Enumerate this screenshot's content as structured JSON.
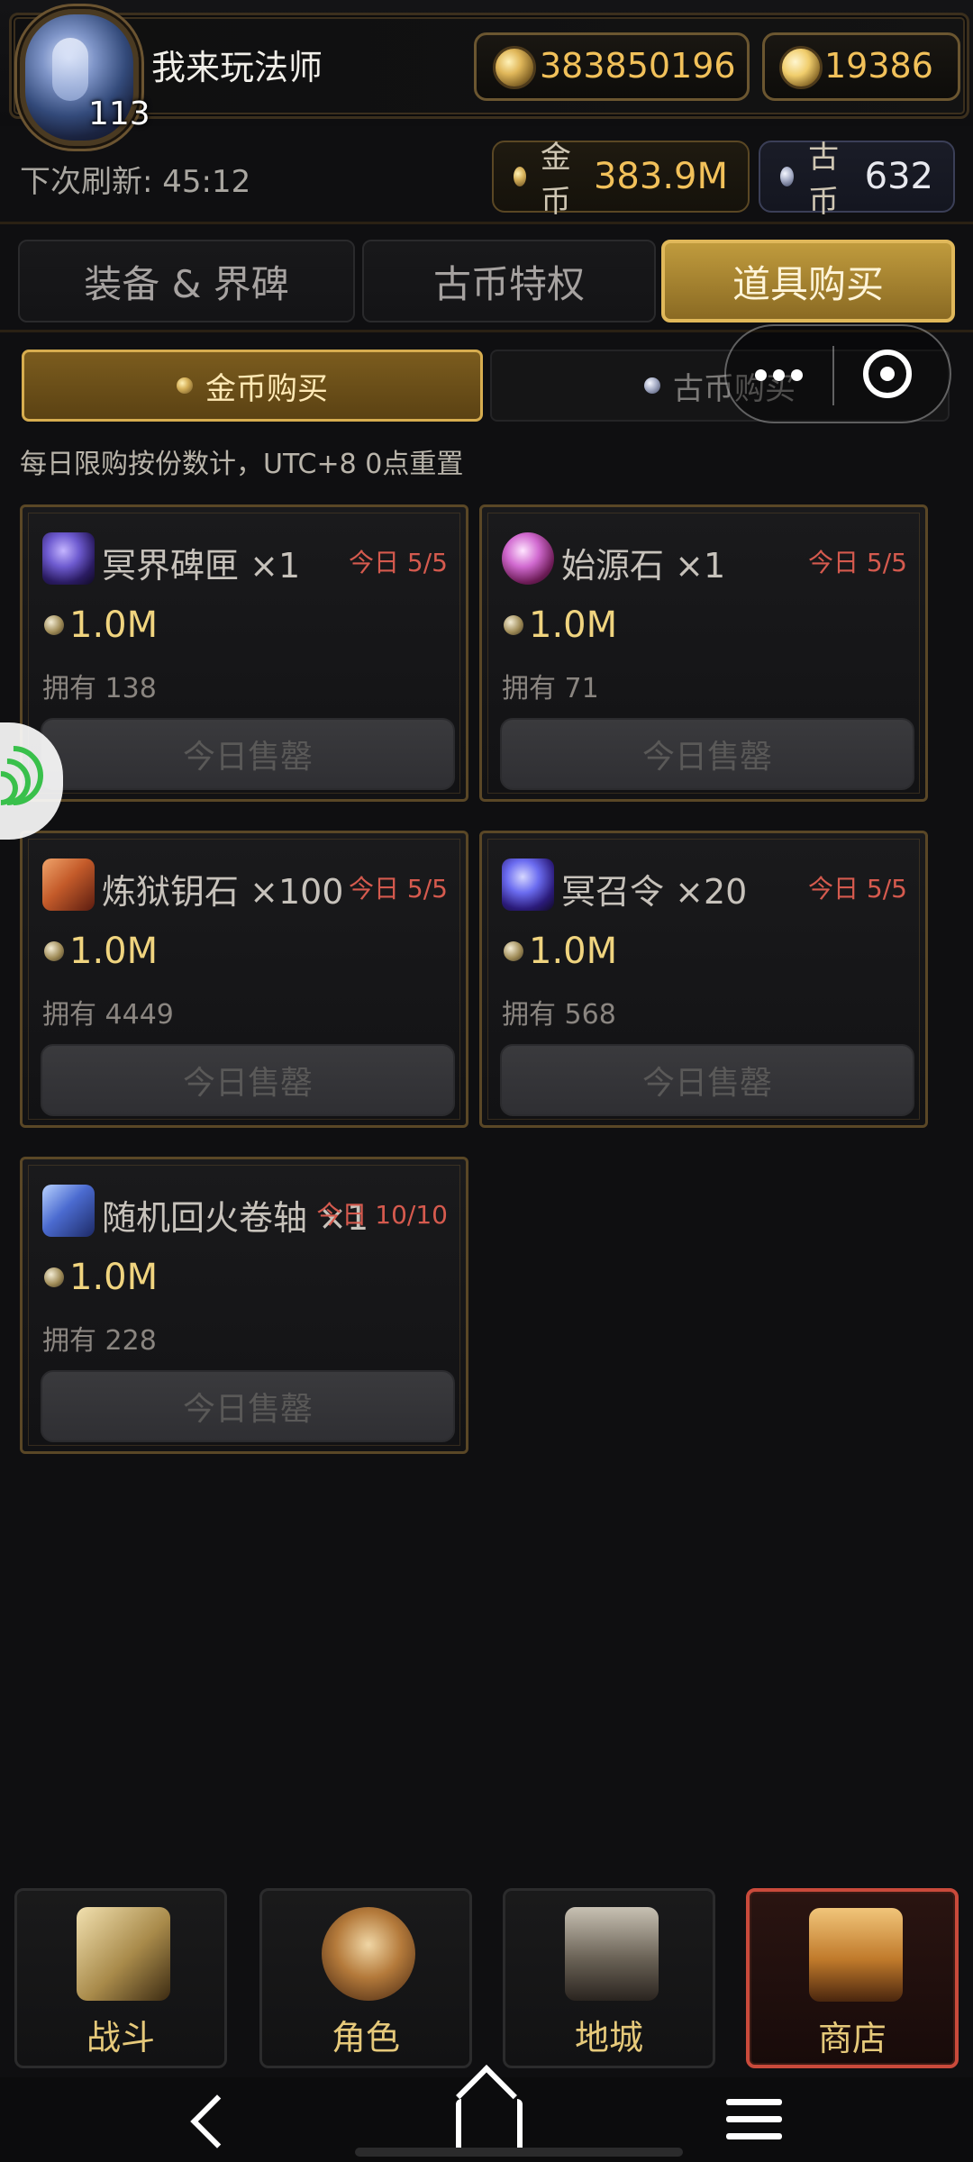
{
  "header": {
    "player_name": "我来玩法师",
    "level": "113",
    "currency_primary": "383850196",
    "currency_secondary": "19386"
  },
  "status": {
    "next_refresh_label": "下次刷新:",
    "next_refresh_time": "45:12",
    "gold_label": "金币",
    "gold_value": "383.9M",
    "ancient_label": "古币",
    "ancient_value": "632"
  },
  "tabs": {
    "main": [
      {
        "label": "装备 & 界碑",
        "active": false
      },
      {
        "label": "古币特权",
        "active": false
      },
      {
        "label": "道具购买",
        "active": true
      }
    ],
    "sub": [
      {
        "label": "金币购买",
        "active": true
      },
      {
        "label": "古币购买",
        "active": false
      }
    ]
  },
  "note": "每日限购按份数计，UTC+8 0点重置",
  "items": [
    {
      "name": "冥界碑匣",
      "qty": "×1",
      "daily": "今日 5/5",
      "price": "1.0M",
      "owned": "拥有 138",
      "button": "今日售罄",
      "icon": "box-icon"
    },
    {
      "name": "始源石",
      "qty": "×1",
      "daily": "今日 5/5",
      "price": "1.0M",
      "owned": "拥有 71",
      "button": "今日售罄",
      "icon": "gem-icon"
    },
    {
      "name": "炼狱钥石",
      "qty": "×100",
      "daily": "今日 5/5",
      "price": "1.0M",
      "owned": "拥有 4449",
      "button": "今日售罄",
      "icon": "key-icon"
    },
    {
      "name": "冥召令",
      "qty": "×20",
      "daily": "今日 5/5",
      "price": "1.0M",
      "owned": "拥有 568",
      "button": "今日售罄",
      "icon": "token-icon"
    },
    {
      "name": "随机回火卷轴",
      "qty": "×1",
      "daily": "今日 10/10",
      "price": "1.0M",
      "owned": "拥有 228",
      "button": "今日售罄",
      "icon": "scroll-icon"
    }
  ],
  "bottom_nav": [
    {
      "label": "战斗",
      "icon": "swords-icon",
      "active": false
    },
    {
      "label": "角色",
      "icon": "character-icon",
      "active": false
    },
    {
      "label": "地城",
      "icon": "dungeon-icon",
      "active": false
    },
    {
      "label": "商店",
      "icon": "shop-icon",
      "active": true
    }
  ],
  "colors": {
    "accent_gold": "#f2c15a",
    "danger_red": "#d55a4e",
    "active_tab": "#c09b3d",
    "background": "#0f0f11"
  }
}
